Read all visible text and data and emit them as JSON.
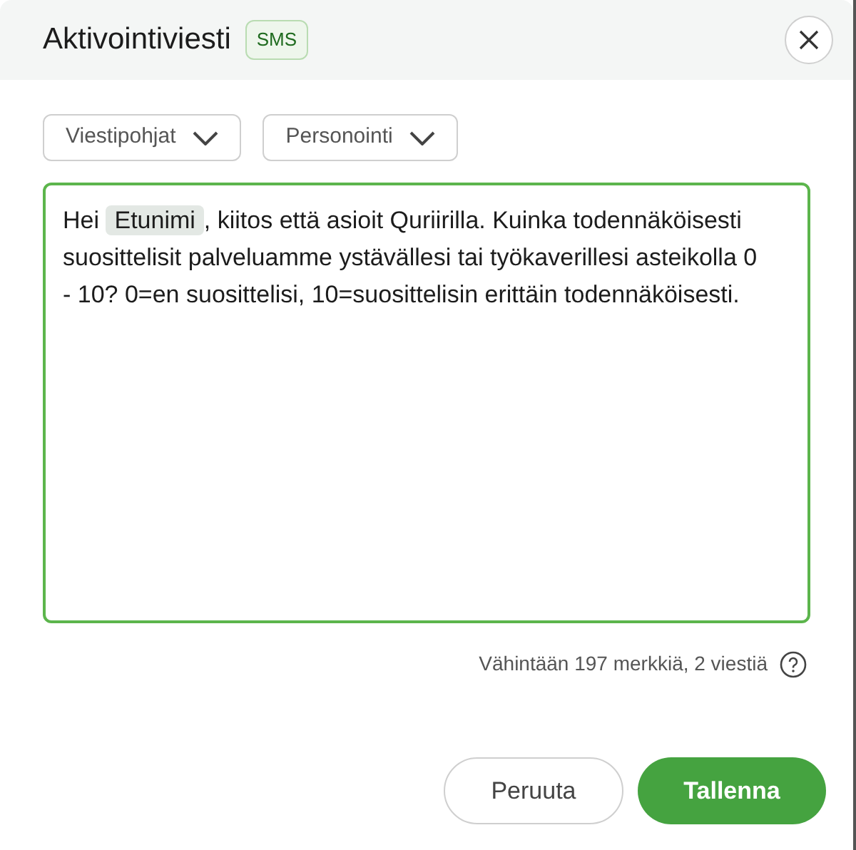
{
  "header": {
    "title": "Aktivointiviesti",
    "badge": "SMS"
  },
  "dropdowns": [
    {
      "label": "Viestipohjat"
    },
    {
      "label": "Personointi"
    }
  ],
  "message": {
    "parts": [
      {
        "kind": "text",
        "text": "Hei "
      },
      {
        "kind": "tag",
        "text": "Etunimi"
      },
      {
        "kind": "text",
        "text": ", kiitos että asioit Quriirilla. Kuinka todennäköisesti suosittelisit palveluamme ystävällesi tai työkaverillesi asteikolla 0 - 10? 0=en suosittelisi, 10=suosittelisin erittäin todennäköisesti."
      }
    ]
  },
  "counter": "Vähintään 197 merkkiä, 2 viestiä",
  "buttons": [
    {
      "label": "Peruuta",
      "kind": "secondary"
    },
    {
      "label": "Tallenna",
      "kind": "primary"
    }
  ]
}
